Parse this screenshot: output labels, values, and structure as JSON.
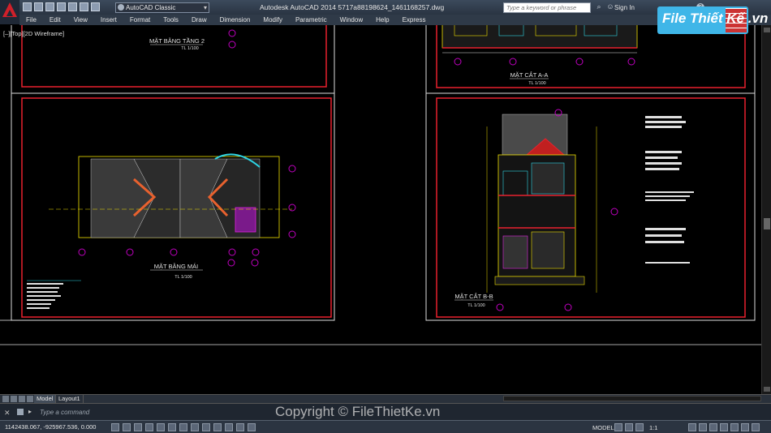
{
  "title_bar": {
    "workspace": "AutoCAD Classic",
    "title": "Autodesk AutoCAD 2014     5717a88198624_1461168257.dwg",
    "search_placeholder": "Type a keyword or phrase",
    "sign_in": "Sign In",
    "help": "?"
  },
  "menu": [
    "File",
    "Edit",
    "View",
    "Insert",
    "Format",
    "Tools",
    "Draw",
    "Dimension",
    "Modify",
    "Parametric",
    "Window",
    "Help",
    "Express"
  ],
  "viewport_label": "[–][Top][2D Wireframe]",
  "drawings": {
    "tl_title": "MẶT BẰNG TẦNG 2",
    "tl_scale": "TL  1/100",
    "tr_title": "MẶT CẮT A-A",
    "tr_scale": "TL  1/100",
    "bl_title": "MẶT BẰNG MÁI",
    "bl_scale": "TL  1/100",
    "br_title": "MẶT CẮT B-B",
    "br_scale": "TL  1/100"
  },
  "logo": {
    "text": "File Thiết Kế .vn"
  },
  "tabs": [
    "Model",
    "Layout1"
  ],
  "command": {
    "placeholder": "Type a command"
  },
  "status": {
    "coords": "1142438.067, -925967.536, 0.000",
    "model": "MODEL",
    "scale": "1:1"
  },
  "watermark": "Copyright © FileThietKe.vn",
  "colors": {
    "sheet_border": "#e8212e",
    "frame": "#dcdcdc",
    "cyan": "#2dd4e4",
    "yellow": "#f0e000",
    "magenta": "#e020e0"
  }
}
